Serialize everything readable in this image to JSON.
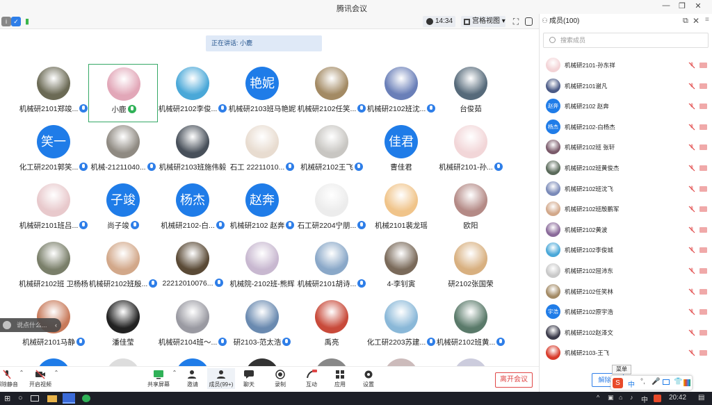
{
  "window": {
    "title": "腾讯会议"
  },
  "toolbar": {
    "time": "14:34",
    "view_label": "宫格视图"
  },
  "speaking": "正在讲话: 小鹿",
  "tiles": [
    {
      "name": "机械研2101郑竣...",
      "avatar": "photo",
      "color": "#6b6a55",
      "mic": "blue"
    },
    {
      "name": "小鹿",
      "avatar": "photo",
      "color": "#e2a7b8",
      "mic": "green"
    },
    {
      "name": "机械研2102李俊...",
      "avatar": "photo",
      "color": "#4aa8d8",
      "mic": "blue"
    },
    {
      "name": "机械研2103班马艳妮",
      "avatar": "艳妮",
      "mic": ""
    },
    {
      "name": "机械研2102任笑...",
      "avatar": "photo",
      "color": "#a38a64",
      "mic": "blue"
    },
    {
      "name": "机械研2102班沈...",
      "avatar": "photo",
      "color": "#6a7fb8",
      "mic": "blue"
    },
    {
      "name": "台俊茹",
      "avatar": "photo",
      "color": "#566a7a",
      "mic": ""
    },
    {
      "name": "化工研2201郭笑...",
      "avatar": "笑一",
      "mic": "blue"
    },
    {
      "name": "机械-21211040...",
      "avatar": "photo",
      "color": "#8f8a82",
      "mic": "blue"
    },
    {
      "name": "机械研2103班施伟毅",
      "avatar": "photo",
      "color": "#48505a",
      "mic": ""
    },
    {
      "name": "石工 22211010...",
      "avatar": "photo",
      "color": "#e8dcd0",
      "mic": "blue"
    },
    {
      "name": "机械研2102王飞",
      "avatar": "photo",
      "color": "#c8c6c2",
      "mic": "blue"
    },
    {
      "name": "曹佳君",
      "avatar": "佳君",
      "mic": ""
    },
    {
      "name": "机械研2101-孙...",
      "avatar": "photo",
      "color": "#f2d6d8",
      "mic": "blue"
    },
    {
      "name": "机械研2101班吕...",
      "avatar": "photo",
      "color": "#e8c9cc",
      "mic": "blue"
    },
    {
      "name": "尚子竣",
      "avatar": "子竣",
      "mic": "blue"
    },
    {
      "name": "机械研2102-白...",
      "avatar": "杨杰",
      "mic": "blue"
    },
    {
      "name": "机械研2102 赵奔",
      "avatar": "赵奔",
      "mic": "blue"
    },
    {
      "name": "石工研2204宁朋...",
      "avatar": "photo",
      "color": "#ececec",
      "mic": "blue"
    },
    {
      "name": "机械2101裴龙瑶",
      "avatar": "photo",
      "color": "#f0c48a",
      "mic": ""
    },
    {
      "name": "欧阳",
      "avatar": "photo",
      "color": "#b48a86",
      "mic": ""
    },
    {
      "name": "机械研2102班 卫杨杨",
      "avatar": "photo",
      "color": "#7a7f6a",
      "mic": ""
    },
    {
      "name": "机械研2102班殷...",
      "avatar": "photo",
      "color": "#d2a88a",
      "mic": "blue"
    },
    {
      "name": "22212010076...",
      "avatar": "photo",
      "color": "#5a4a36",
      "mic": "blue"
    },
    {
      "name": "机械院-2102班-熊辉",
      "avatar": "photo",
      "color": "#c8b8d0",
      "mic": ""
    },
    {
      "name": "机械研2101胡诗...",
      "avatar": "photo",
      "color": "#8aa8c8",
      "mic": "blue"
    },
    {
      "name": "4-李钊寅",
      "avatar": "photo",
      "color": "#7a6a5a",
      "mic": ""
    },
    {
      "name": "研2102张国荣",
      "avatar": "photo",
      "color": "#d8b080",
      "mic": ""
    },
    {
      "name": "机械研2101马静",
      "avatar": "photo",
      "color": "#c87a5a",
      "mic": "blue"
    },
    {
      "name": "潘佳莹",
      "avatar": "photo",
      "color": "#222222",
      "mic": ""
    },
    {
      "name": "机械研2104班～...",
      "avatar": "photo",
      "color": "#9a9aa2",
      "mic": "blue"
    },
    {
      "name": "研2103-范太浩",
      "avatar": "photo",
      "color": "#6a8ab0",
      "mic": "blue"
    },
    {
      "name": "禹亮",
      "avatar": "photo",
      "color": "#c84a3a",
      "mic": ""
    },
    {
      "name": "化工研2203苏建...",
      "avatar": "photo",
      "color": "#8ab8d8",
      "mic": "blue"
    },
    {
      "name": "机械研2102班黄...",
      "avatar": "photo",
      "color": "#5a7a6a",
      "mic": "blue"
    }
  ],
  "comment_placeholder": "说点什么...",
  "bottombar": {
    "mute": "解除静音",
    "video": "开启视频",
    "share": "共享屏幕",
    "invite": "邀请",
    "members": "成员(99+)",
    "chat": "聊天",
    "record": "录制",
    "interact": "互动",
    "apps": "应用",
    "settings": "设置",
    "leave": "离开会议"
  },
  "panel": {
    "title": "成员(100)",
    "search_placeholder": "搜索成员",
    "members": [
      {
        "name": "机械研2101-孙东祥",
        "avatar": "photo",
        "color": "#f3d3d6"
      },
      {
        "name": "机械研2101谢凡",
        "avatar": "photo",
        "color": "#4a5a86"
      },
      {
        "name": "机械研2102 赵奔",
        "avatar": "赵奔"
      },
      {
        "name": "机械研2102-白杨杰",
        "avatar": "杨杰"
      },
      {
        "name": "机械研2102班 张轩",
        "avatar": "photo",
        "color": "#7a5a6a"
      },
      {
        "name": "机械研2102班黄俊杰",
        "avatar": "photo",
        "color": "#5a6a5a"
      },
      {
        "name": "机械研2102班沈飞",
        "avatar": "photo",
        "color": "#7a8ab8"
      },
      {
        "name": "机械研2102班殷鹏军",
        "avatar": "photo",
        "color": "#d2a88a"
      },
      {
        "name": "机械研2102黄波",
        "avatar": "photo",
        "color": "#8a6a9a"
      },
      {
        "name": "机械研2102李俊城",
        "avatar": "photo",
        "color": "#4aa8d8"
      },
      {
        "name": "机械研2102屈沛东",
        "avatar": "photo",
        "color": "#c8c8c8"
      },
      {
        "name": "机械研2102任笑林",
        "avatar": "photo",
        "color": "#a38a64"
      },
      {
        "name": "机械研2102原宇浩",
        "avatar": "宇浩"
      },
      {
        "name": "机械研2102赵泽文",
        "avatar": "photo",
        "color": "#3a3a4a"
      },
      {
        "name": "机械研2103-王飞",
        "avatar": "photo",
        "color": "#d83a2a"
      }
    ],
    "unmute_all": "解除静",
    "tooltip": "菜单"
  },
  "taskbar": {
    "ime_lang": "中",
    "time": "20:42"
  }
}
